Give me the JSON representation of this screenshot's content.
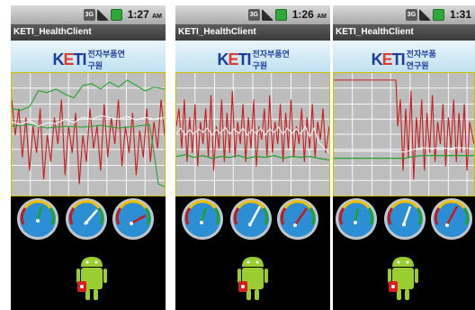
{
  "screens": [
    {
      "status": {
        "data_icon": "3G",
        "signal_icon": "signal-icon",
        "battery_icon": "battery-icon",
        "time": "1:27",
        "ampm": "AM"
      },
      "title": "KETI_HealthClient",
      "banner": {
        "logo_main_pre": "K",
        "logo_main_e": "E",
        "logo_main_post": "TI",
        "logo_sub": "전자부품연구원"
      }
    },
    {
      "status": {
        "data_icon": "3G",
        "signal_icon": "signal-icon",
        "battery_icon": "battery-icon",
        "time": "1:26",
        "ampm": "AM"
      },
      "title": "KETI_HealthClient",
      "banner": {
        "logo_main_pre": "K",
        "logo_main_e": "E",
        "logo_main_post": "TI",
        "logo_sub": "전자부품연구원"
      }
    },
    {
      "status": {
        "data_icon": "3G",
        "signal_icon": "signal-icon",
        "battery_icon": "battery-icon",
        "time": "1:31",
        "ampm": ""
      },
      "title": "KETI_HealthClient",
      "banner": {
        "logo_main_pre": "K",
        "logo_main_e": "E",
        "logo_main_post": "TI",
        "logo_sub": "전자부품연구원"
      }
    }
  ],
  "colors": {
    "red_trace": "#c8191b",
    "green_trace": "#23a12a",
    "white_trace": "#f4f4f4",
    "gauge_face": "#2c8fd6",
    "graph_border": "#c8c000"
  }
}
